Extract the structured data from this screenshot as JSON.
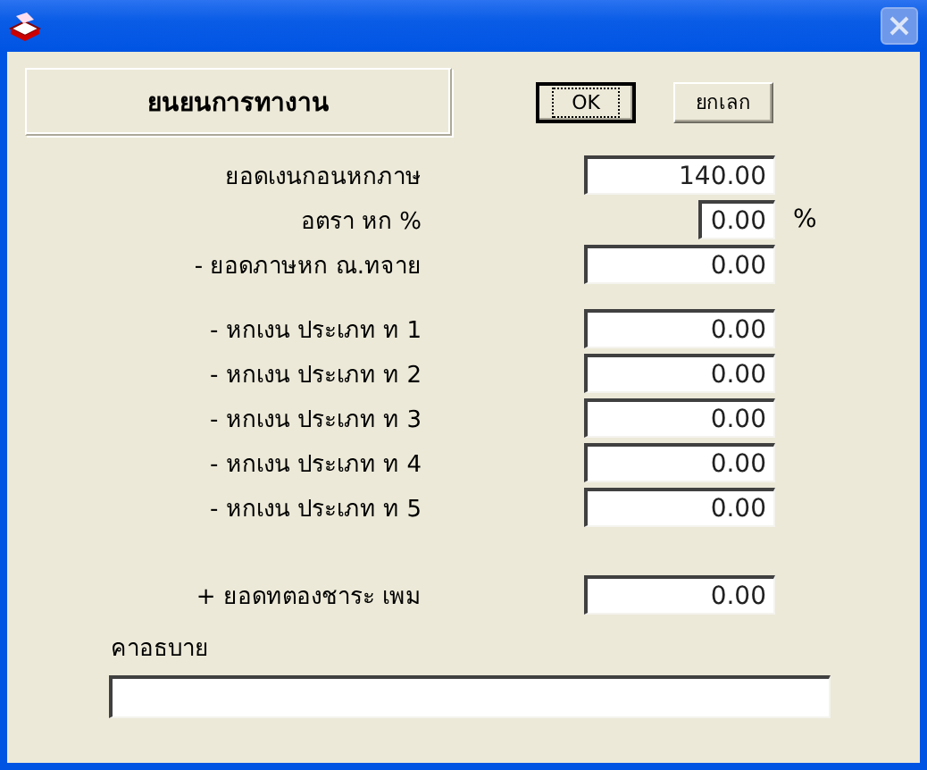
{
  "header": "ยนยนการทางาน",
  "buttons": [
    {
      "label": "OK",
      "focused": true
    },
    {
      "label": "ยกเลก",
      "focused": false
    }
  ],
  "groups": [
    [
      {
        "label": "ยอดเงนกอนหกภาษ",
        "value": "140.00"
      },
      {
        "label": "อตรา หก %",
        "value": "0.00",
        "unit": "%"
      },
      {
        "label": "- ยอดภาษหก ณ.ทจาย",
        "value": "0.00"
      }
    ],
    [
      {
        "label": "- หกเงน ประเภท ท 1",
        "value": "0.00"
      },
      {
        "label": "- หกเงน ประเภท ท 2",
        "value": "0.00"
      },
      {
        "label": "- หกเงน ประเภท ท 3",
        "value": "0.00"
      },
      {
        "label": "- หกเงน ประเภท ท 4",
        "value": "0.00"
      },
      {
        "label": "- หกเงน ประเภท ท 5",
        "value": "0.00"
      }
    ],
    [
      {
        "label": "+ ยอดทตองชาระ เพม",
        "value": "0.00"
      }
    ]
  ],
  "note": {
    "label": "คาอธบาย"
  }
}
